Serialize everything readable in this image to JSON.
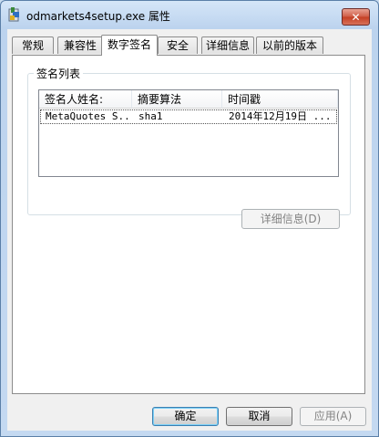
{
  "window": {
    "title": "odmarkets4setup.exe 属性",
    "close_label": "✕"
  },
  "tabs": [
    {
      "label": "常规",
      "active": false
    },
    {
      "label": "兼容性",
      "active": false
    },
    {
      "label": "数字签名",
      "active": true
    },
    {
      "label": "安全",
      "active": false
    },
    {
      "label": "详细信息",
      "active": false
    },
    {
      "label": "以前的版本",
      "active": false
    }
  ],
  "signature_list": {
    "group_label": "签名列表",
    "columns": [
      "签名人姓名:",
      "摘要算法",
      "时间戳"
    ],
    "rows": [
      {
        "signer": "MetaQuotes S...",
        "digest": "sha1",
        "timestamp": "2014年12月19日 ..."
      }
    ],
    "details_button": "详细信息(D)"
  },
  "buttons": {
    "ok": "确定",
    "cancel": "取消",
    "apply": "应用(A)"
  }
}
